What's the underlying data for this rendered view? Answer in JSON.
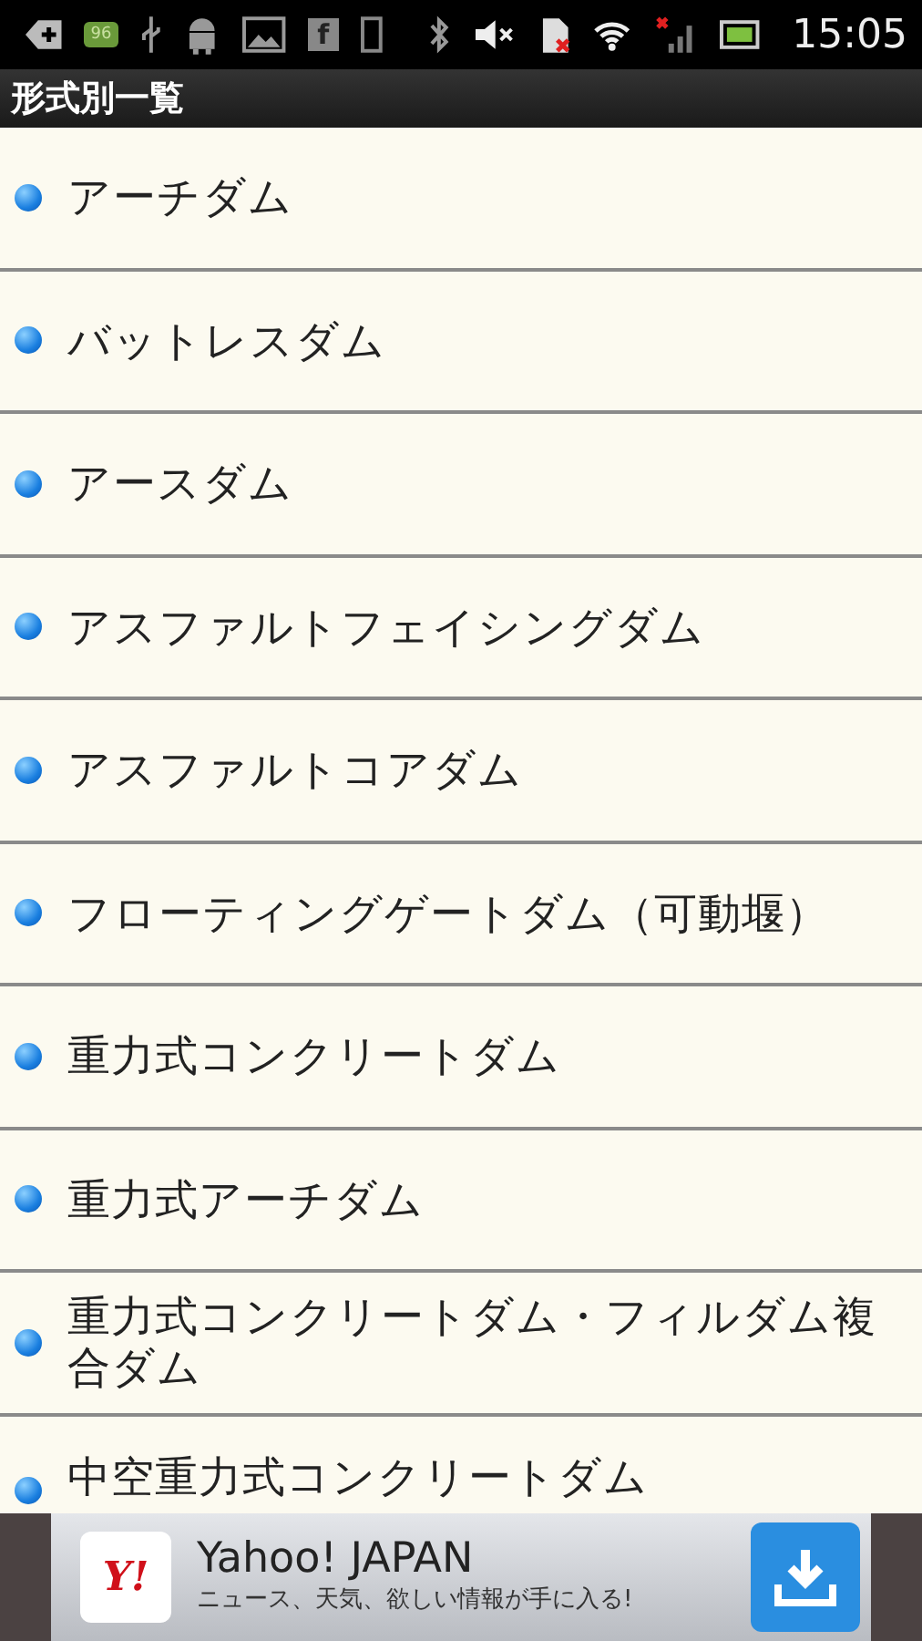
{
  "status_bar": {
    "battery_badge": "96",
    "facebook_glyph": "f",
    "time": "15:05"
  },
  "title_bar": {
    "title": "形式別一覧"
  },
  "items": [
    {
      "label": "アーチダム"
    },
    {
      "label": "バットレスダム"
    },
    {
      "label": "アースダム"
    },
    {
      "label": "アスファルトフェイシングダム"
    },
    {
      "label": "アスファルトコアダム"
    },
    {
      "label": "フローティングゲートダム（可動堰）"
    },
    {
      "label": "重力式コンクリートダム"
    },
    {
      "label": "重力式アーチダム"
    },
    {
      "label": "重力式コンクリートダム・フィルダム複合ダム"
    },
    {
      "label": "中空重力式コンクリートダム"
    }
  ],
  "ad_banner": {
    "logo_text": "Y!",
    "title": "Yahoo! JAPAN",
    "subtitle": "ニュース、天気、欲しい情報が手に入る!"
  }
}
